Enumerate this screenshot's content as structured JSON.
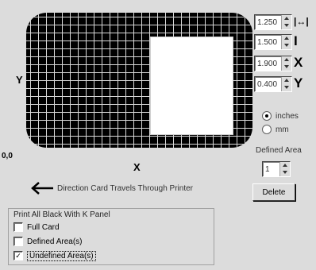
{
  "preview": {
    "y_label": "Y",
    "x_label": "X",
    "origin_label": "0,0",
    "direction_text": "Direction Card Travels Through Printer"
  },
  "dimensions": [
    {
      "value": "1.250",
      "icon": "width-icon",
      "glyph": "|↔|"
    },
    {
      "value": "1.500",
      "icon": "height-icon",
      "glyph": "I"
    },
    {
      "value": "1.900",
      "icon": "x-offset-icon",
      "glyph": "X"
    },
    {
      "value": "0.400",
      "icon": "y-offset-icon",
      "glyph": "Y"
    }
  ],
  "units": {
    "inches_label": "inches",
    "mm_label": "mm",
    "selected": "inches"
  },
  "defined_area": {
    "label": "Defined Area",
    "value": "1"
  },
  "delete_label": "Delete",
  "print_black": {
    "title": "Print All Black With K Panel",
    "options": [
      {
        "label": "Full Card",
        "checked": false
      },
      {
        "label": "Defined Area(s)",
        "checked": false
      },
      {
        "label": "Undefined Area(s)",
        "checked": true
      }
    ]
  }
}
